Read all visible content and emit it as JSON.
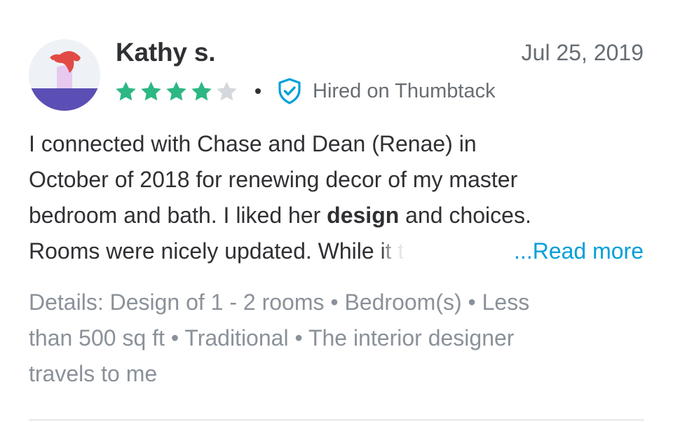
{
  "review": {
    "reviewer_name": "Kathy s.",
    "date": "Jul 25, 2019",
    "rating": 4,
    "rating_max": 5,
    "separator": "•",
    "hired_label": "Hired on Thumbtack",
    "body": {
      "line1": "I connected with Chase and Dean (Renae) in",
      "line2": "October of 2018 for renewing decor of my master",
      "line3_before": "bedroom and bath. I liked her ",
      "line3_bold": "design",
      "line3_after": " and choices.",
      "line4_visible": "Rooms were nicely updated. While ",
      "line4_faded": "it t"
    },
    "read_more_label": "...Read more",
    "details": {
      "line1": "Details: Design of 1 - 2 rooms • Bedroom(s) • Less",
      "line2": "than 500 sq ft • Traditional • The interior designer",
      "line3": "travels to me"
    },
    "icons": {
      "avatar": "avatar-illustration",
      "star_filled": "star-filled-icon",
      "star_empty": "star-empty-icon",
      "verified": "verified-shield-icon"
    },
    "colors": {
      "star_filled": "#2db783",
      "star_empty": "#d5d8dc",
      "link": "#009fd9",
      "shield": "#009fd9",
      "text_primary": "#2f3033",
      "text_secondary": "#676d73",
      "text_details": "#8a9199"
    }
  }
}
